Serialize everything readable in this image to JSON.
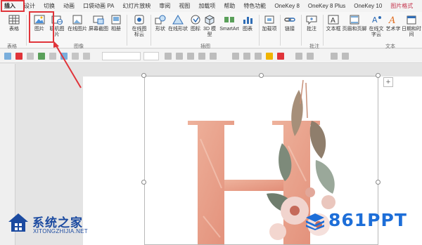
{
  "tabs": [
    {
      "label": "插入",
      "active": true
    },
    {
      "label": "设计"
    },
    {
      "label": "切换"
    },
    {
      "label": "动画"
    },
    {
      "label": "口袋动画 PA"
    },
    {
      "label": "幻灯片放映"
    },
    {
      "label": "审阅"
    },
    {
      "label": "视图"
    },
    {
      "label": "加载项"
    },
    {
      "label": "帮助"
    },
    {
      "label": "特色功能"
    },
    {
      "label": "OneKey 8"
    },
    {
      "label": "OneKey 8 Plus"
    },
    {
      "label": "OneKey 10"
    },
    {
      "label": "图片格式",
      "contextual": true
    }
  ],
  "ribbon": {
    "table_label": "表格",
    "picture_label": "图片",
    "online_picture_label": "联机图片",
    "online_picture2_label": "在线图片",
    "screenshot_label": "屏幕截图",
    "album_label": "相册",
    "online_icons_label": "在线图标云",
    "shapes_label": "形状",
    "online_shapes_label": "在线形状",
    "icons_label": "图标",
    "model3d_label": "3D 模型",
    "smartart_label": "SmartArt",
    "chart_label": "图表",
    "addins_label": "加载项",
    "link_label": "链接",
    "comment_label": "批注",
    "textbox_label": "文本框",
    "header_footer_label": "页眉和页脚",
    "online_text_label": "在线文字云",
    "wordart_label": "艺术字",
    "datetime_label": "日期和时间",
    "groups": {
      "tables": "表格",
      "images": "图像",
      "illustrations": "插图",
      "comments": "批注",
      "text": "文本"
    }
  },
  "workspace": {
    "plus_glyph": "+"
  },
  "watermarks": {
    "left_title": "系统之家",
    "left_url": "XITONGZHIJIA.NET",
    "right_brand": "861PPT"
  },
  "colors": {
    "highlight": "#e0343a",
    "letter": "#e8a48e",
    "brand_blue": "#1d6ed8"
  }
}
